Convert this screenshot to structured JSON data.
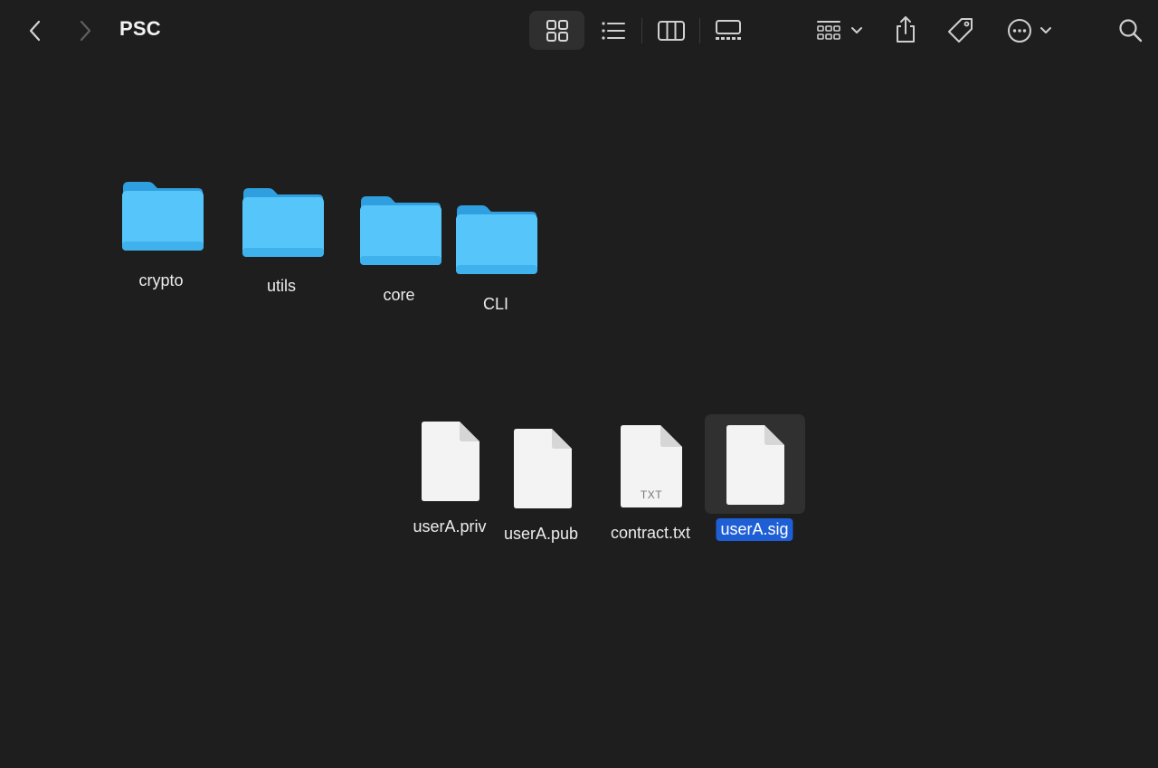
{
  "window": {
    "title": "PSC"
  },
  "toolbar": {
    "back": "chevron-left-icon",
    "forward": "chevron-right-icon",
    "views": [
      "icon-view-icon",
      "list-view-icon",
      "column-view-icon",
      "gallery-view-icon"
    ],
    "active_view": "icon-view",
    "group": "group-icon",
    "share": "share-icon",
    "tag": "tag-icon",
    "more": "more-icon",
    "search": "search-icon"
  },
  "folders": [
    {
      "name": "crypto"
    },
    {
      "name": "utils"
    },
    {
      "name": "core"
    },
    {
      "name": "CLI"
    }
  ],
  "files": [
    {
      "name": "userA.priv"
    },
    {
      "name": "userA.pub"
    },
    {
      "name": "contract.txt",
      "badge": "TXT"
    },
    {
      "name": "userA.sig",
      "selected": true
    }
  ],
  "colors": {
    "background": "#1e1e1e",
    "folder": "#4fc3f7",
    "selection": "#1f5fd6"
  }
}
